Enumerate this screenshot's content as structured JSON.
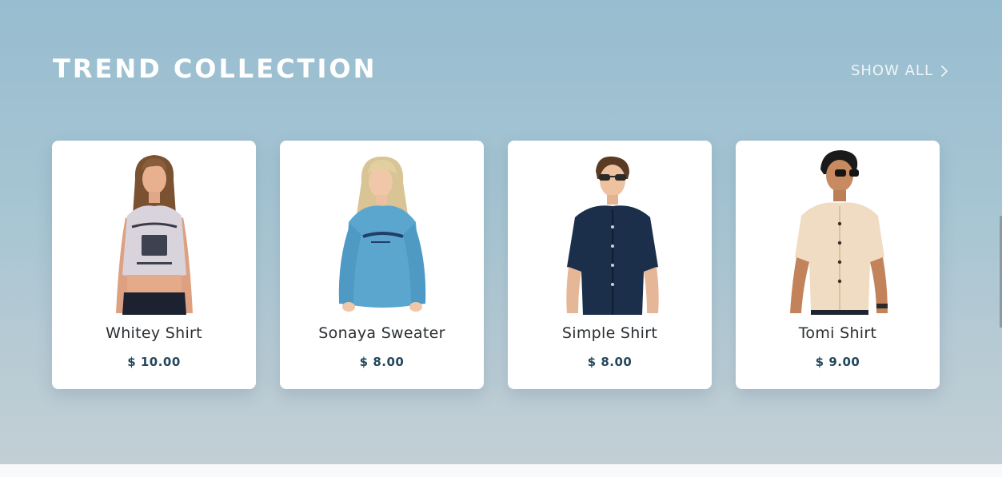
{
  "section": {
    "title": "TREND COLLECTION",
    "show_all_label": "SHOW ALL"
  },
  "products": [
    {
      "name": "Whitey Shirt",
      "price": "$ 10.00",
      "image": "woman-crop-top-icon"
    },
    {
      "name": "Sonaya Sweater",
      "price": "$ 8.00",
      "image": "woman-sweater-icon"
    },
    {
      "name": "Simple Shirt",
      "price": "$ 8.00",
      "image": "man-dark-shirt-icon"
    },
    {
      "name": "Tomi Shirt",
      "price": "$ 9.00",
      "image": "man-beige-shirt-icon"
    }
  ],
  "colors": {
    "gradient_top": "#97bdd0",
    "gradient_bottom": "#c3cfd5",
    "title": "#ffffff",
    "price": "#24475c",
    "card": "#ffffff"
  }
}
